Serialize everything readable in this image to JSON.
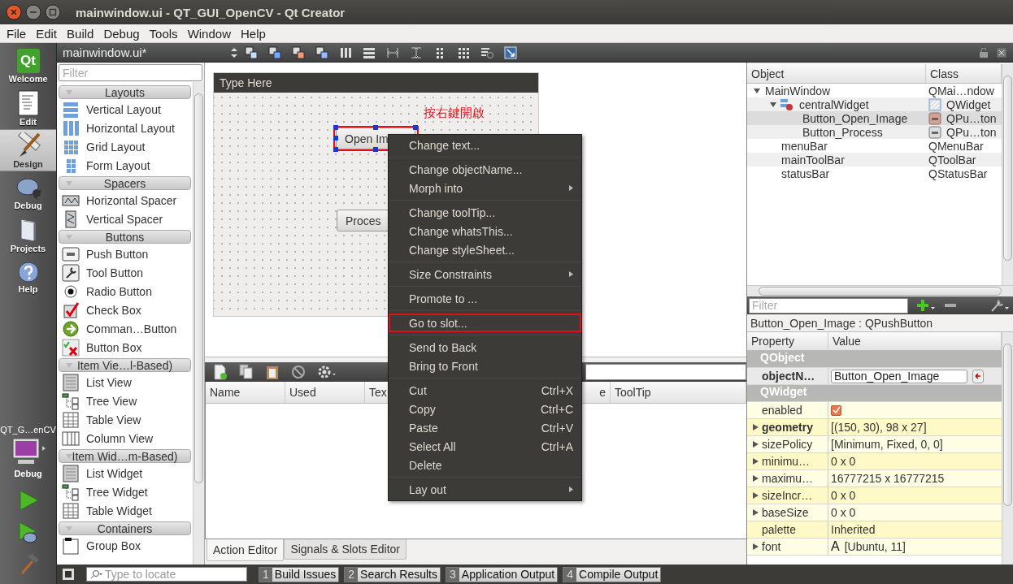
{
  "window": {
    "title": "mainwindow.ui - QT_GUI_OpenCV - Qt Creator"
  },
  "menu_bar": [
    "File",
    "Edit",
    "Build",
    "Debug",
    "Tools",
    "Window",
    "Help"
  ],
  "mode_bar": {
    "logo_text": "Qt",
    "modes": [
      {
        "label": "Welcome",
        "selected": false
      },
      {
        "label": "Edit",
        "selected": false
      },
      {
        "label": "Design",
        "selected": true
      },
      {
        "label": "Debug",
        "selected": false
      },
      {
        "label": "Projects",
        "selected": false
      },
      {
        "label": "Help",
        "selected": false
      }
    ],
    "target": {
      "project": "QT_G…enCV",
      "config": "Debug"
    }
  },
  "editor_toolbar": {
    "document": "mainwindow.ui*"
  },
  "widget_box": {
    "filter_placeholder": "Filter",
    "categories": [
      {
        "title": "Layouts",
        "expanded": true,
        "items": [
          "Vertical Layout",
          "Horizontal Layout",
          "Grid Layout",
          "Form Layout"
        ]
      },
      {
        "title": "Spacers",
        "expanded": true,
        "items": [
          "Horizontal Spacer",
          "Vertical Spacer"
        ]
      },
      {
        "title": "Buttons",
        "expanded": true,
        "items": [
          "Push Button",
          "Tool Button",
          "Radio Button",
          "Check Box",
          "Comman…Button",
          "Button Box"
        ]
      },
      {
        "title": "Item Vie…l-Based)",
        "expanded": true,
        "items": [
          "List View",
          "Tree View",
          "Table View",
          "Column View"
        ]
      },
      {
        "title": "Item Wid…m-Based)",
        "expanded": true,
        "items": [
          "List Widget",
          "Tree Widget",
          "Table Widget"
        ]
      },
      {
        "title": "Containers",
        "expanded": true,
        "items": [
          "Group Box"
        ]
      }
    ]
  },
  "form": {
    "menu_placeholder": "Type Here",
    "annotation": "按右鍵開啟",
    "buttons": [
      {
        "text": "Open Im",
        "selected": true
      },
      {
        "text": "Proces",
        "selected": false
      }
    ]
  },
  "context_menu": [
    {
      "kind": "action",
      "label": "Change text...",
      "marked": false
    },
    {
      "kind": "separator"
    },
    {
      "kind": "action",
      "label": "Change objectName...",
      "marked": false
    },
    {
      "kind": "action",
      "label": "Morph into",
      "submenu": true,
      "marked": false
    },
    {
      "kind": "separator"
    },
    {
      "kind": "action",
      "label": "Change toolTip...",
      "marked": false
    },
    {
      "kind": "action",
      "label": "Change whatsThis...",
      "marked": false
    },
    {
      "kind": "action",
      "label": "Change styleSheet...",
      "marked": false
    },
    {
      "kind": "separator"
    },
    {
      "kind": "action",
      "label": "Size Constraints",
      "submenu": true,
      "marked": false
    },
    {
      "kind": "separator"
    },
    {
      "kind": "action",
      "label": "Promote to ...",
      "marked": false
    },
    {
      "kind": "separator"
    },
    {
      "kind": "action",
      "label": "Go to slot...",
      "marked": true
    },
    {
      "kind": "separator"
    },
    {
      "kind": "action",
      "label": "Send to Back",
      "marked": false
    },
    {
      "kind": "action",
      "label": "Bring to Front",
      "marked": false
    },
    {
      "kind": "separator"
    },
    {
      "kind": "action",
      "label": "Cut",
      "shortcut": "Ctrl+X",
      "marked": false
    },
    {
      "kind": "action",
      "label": "Copy",
      "shortcut": "Ctrl+C",
      "marked": false
    },
    {
      "kind": "action",
      "label": "Paste",
      "shortcut": "Ctrl+V",
      "marked": false
    },
    {
      "kind": "action",
      "label": "Select All",
      "shortcut": "Ctrl+A",
      "marked": false
    },
    {
      "kind": "action",
      "label": "Delete",
      "marked": false
    },
    {
      "kind": "separator"
    },
    {
      "kind": "action",
      "label": "Lay out",
      "submenu": true,
      "marked": false
    }
  ],
  "action_editor": {
    "columns": [
      "Name",
      "Used",
      "Tex",
      "e",
      "ToolTip"
    ],
    "tabs": [
      {
        "label": "Action Editor",
        "selected": true
      },
      {
        "label": "Signals & Slots Editor",
        "selected": false
      }
    ]
  },
  "object_inspector": {
    "columns": [
      "Object",
      "Class"
    ],
    "tree": [
      {
        "name": "MainWindow",
        "class": "QMai…ndow",
        "expanded": true,
        "selected": false,
        "children": [
          {
            "name": "centralWidget",
            "class": "QWidget",
            "expanded": true,
            "selected": false,
            "children": [
              {
                "name": "Button_Open_Image",
                "class": "QPu…ton",
                "selected": true
              },
              {
                "name": "Button_Process",
                "class": "QPu…ton",
                "selected": false
              }
            ]
          },
          {
            "name": "menuBar",
            "class": "QMenuBar",
            "selected": false
          },
          {
            "name": "mainToolBar",
            "class": "QToolBar",
            "selected": false
          },
          {
            "name": "statusBar",
            "class": "QStatusBar",
            "selected": false
          }
        ]
      }
    ]
  },
  "property_editor": {
    "filter_placeholder": "Filter",
    "title": "Button_Open_Image : QPushButton",
    "columns": [
      "Property",
      "Value"
    ],
    "rows": [
      {
        "kind": "group",
        "name": "QObject"
      },
      {
        "kind": "edit",
        "name": "objectN…",
        "value": "Button_Open_Image",
        "bold": true,
        "expandable": false
      },
      {
        "kind": "group",
        "name": "QWidget"
      },
      {
        "kind": "check",
        "name": "enabled",
        "checked": true,
        "bold": false,
        "expandable": false
      },
      {
        "kind": "text",
        "name": "geometry",
        "value": "[(150, 30), 98 x 27]",
        "bold": true,
        "expandable": true
      },
      {
        "kind": "text",
        "name": "sizePolicy",
        "value": "[Minimum, Fixed, 0, 0]",
        "bold": false,
        "expandable": true
      },
      {
        "kind": "text",
        "name": "minimu…",
        "value": "0 x 0",
        "bold": false,
        "expandable": true
      },
      {
        "kind": "text",
        "name": "maximu…",
        "value": "16777215 x 16777215",
        "bold": false,
        "expandable": true
      },
      {
        "kind": "text",
        "name": "sizeIncr…",
        "value": "0 x 0",
        "bold": false,
        "expandable": true
      },
      {
        "kind": "text",
        "name": "baseSize",
        "value": "0 x 0",
        "bold": false,
        "expandable": true
      },
      {
        "kind": "text",
        "name": "palette",
        "value": "Inherited",
        "bold": false,
        "expandable": false
      },
      {
        "kind": "font",
        "name": "font",
        "glyph": "A",
        "value": "[Ubuntu, 11]",
        "bold": false,
        "expandable": true
      }
    ]
  },
  "bottom_bar": {
    "locator_placeholder": "Type to locate",
    "panes": [
      {
        "number": "1",
        "label": "Build Issues"
      },
      {
        "number": "2",
        "label": "Search Results"
      },
      {
        "number": "3",
        "label": "Application Output"
      },
      {
        "number": "4",
        "label": "Compile Output"
      }
    ]
  }
}
